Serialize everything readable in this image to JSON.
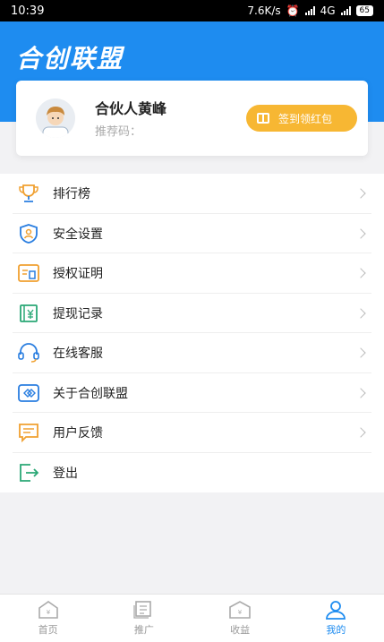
{
  "status_bar": {
    "time": "10:39",
    "speed": "7.6K/s",
    "network": "4G",
    "battery": "65"
  },
  "header": {
    "brand": "合创联盟"
  },
  "profile": {
    "name": "合伙人黄峰",
    "referral_label": "推荐码：",
    "sign_button_label": "签到领红包"
  },
  "menu": {
    "items": [
      {
        "label": "排行榜",
        "icon": "trophy-icon"
      },
      {
        "label": "安全设置",
        "icon": "shield-user-icon"
      },
      {
        "label": "授权证明",
        "icon": "certificate-icon"
      },
      {
        "label": "提现记录",
        "icon": "withdraw-record-icon"
      },
      {
        "label": "在线客服",
        "icon": "headset-icon"
      },
      {
        "label": "关于合创联盟",
        "icon": "about-icon"
      },
      {
        "label": "用户反馈",
        "icon": "feedback-icon"
      },
      {
        "label": "登出",
        "icon": "logout-icon"
      }
    ]
  },
  "tabbar": {
    "tabs": [
      {
        "label": "首页",
        "icon": "home-icon",
        "active": false
      },
      {
        "label": "推广",
        "icon": "promote-icon",
        "active": false
      },
      {
        "label": "收益",
        "icon": "earnings-icon",
        "active": false
      },
      {
        "label": "我的",
        "icon": "profile-icon",
        "active": true
      }
    ]
  },
  "colors": {
    "primary": "#1e8cf0",
    "accent": "#f7b733",
    "icon_orange": "#f0a030",
    "icon_blue": "#2a7ee0",
    "icon_green": "#2aa876"
  }
}
